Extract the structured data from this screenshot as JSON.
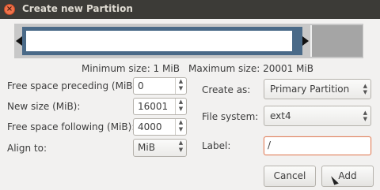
{
  "window": {
    "title": "Create new Partition",
    "close_glyph": "×"
  },
  "size_info": {
    "minimum": "Minimum size: 1 MiB",
    "maximum": "Maximum size: 20001 MiB"
  },
  "fields": {
    "free_preceding": {
      "label": "Free space preceding (MiB):",
      "value": "0"
    },
    "new_size": {
      "label": "New size (MiB):",
      "value": "16001"
    },
    "free_following": {
      "label": "Free space following (MiB):",
      "value": "4000"
    },
    "align_to": {
      "label": "Align to:",
      "value": "MiB"
    },
    "create_as": {
      "label": "Create as:",
      "value": "Primary Partition"
    },
    "file_system": {
      "label": "File system:",
      "value": "ext4"
    },
    "partition_label": {
      "label": "Label:",
      "value": "/"
    }
  },
  "buttons": {
    "cancel": "Cancel",
    "add": "Add"
  },
  "icons": {
    "spin_arrows": "▲▼",
    "combo_arrows": "▲▼"
  },
  "colors": {
    "partition": "#4a6a88",
    "free_space": "#a5a5a5",
    "focus_border": "#e0805c",
    "titlebar": "#3c3b37"
  }
}
